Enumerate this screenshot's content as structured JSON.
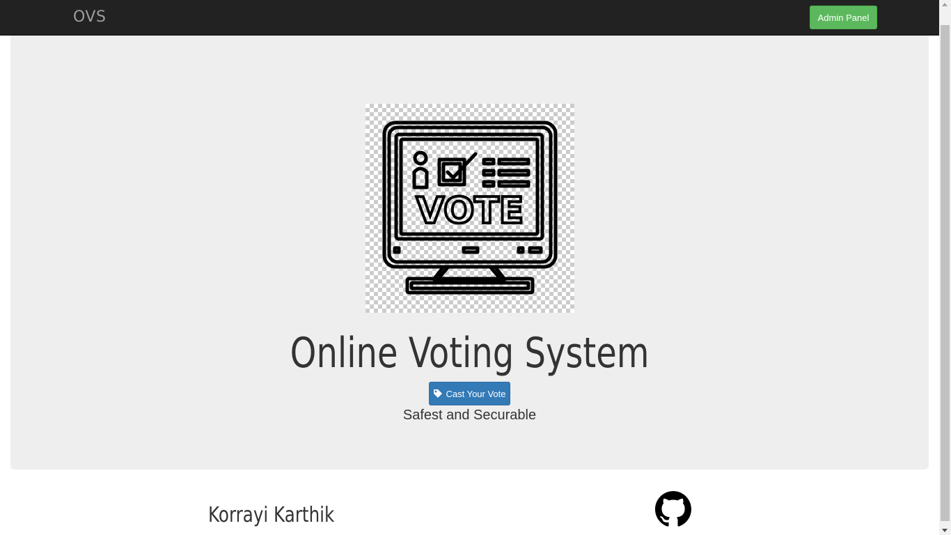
{
  "navbar": {
    "brand": "OVS",
    "admin_button": "Admin Panel"
  },
  "hero": {
    "image_icon": "vote-monitor-icon",
    "image_text": "VOTE",
    "title": "Online Voting System",
    "cast_button": "Cast Your Vote",
    "cast_button_icon": "tag-icon",
    "tagline": "Safest and Securable"
  },
  "footer": {
    "author": "Korrayi Karthik",
    "github_icon": "github-icon"
  },
  "colors": {
    "navbar_bg": "#222222",
    "admin_button": "#5cb85c",
    "cast_button": "#337ab7",
    "jumbotron_bg": "#eeeeee"
  }
}
